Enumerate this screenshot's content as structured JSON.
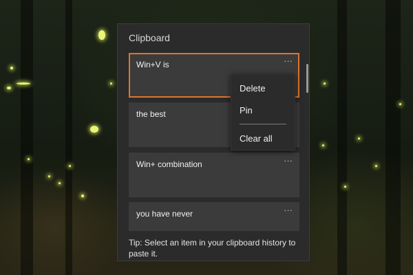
{
  "clipboard": {
    "title": "Clipboard",
    "items": [
      {
        "text": "Win+V is",
        "more_label": "···",
        "selected": true
      },
      {
        "text": "the best",
        "more_label": "···",
        "selected": false
      },
      {
        "text": "Win+ combination",
        "more_label": "···",
        "selected": false
      },
      {
        "text": "you have never",
        "more_label": "···",
        "selected": false
      }
    ],
    "tip": "Tip: Select an item in your clipboard history to paste it."
  },
  "context_menu": {
    "items": [
      "Delete",
      "Pin",
      "Clear all"
    ]
  },
  "colors": {
    "panel_bg": "#2b2b2b",
    "item_bg": "#3b3b3b",
    "selection_accent": "#e0762b"
  },
  "icons": {
    "more": "more-horizontal-icon"
  }
}
